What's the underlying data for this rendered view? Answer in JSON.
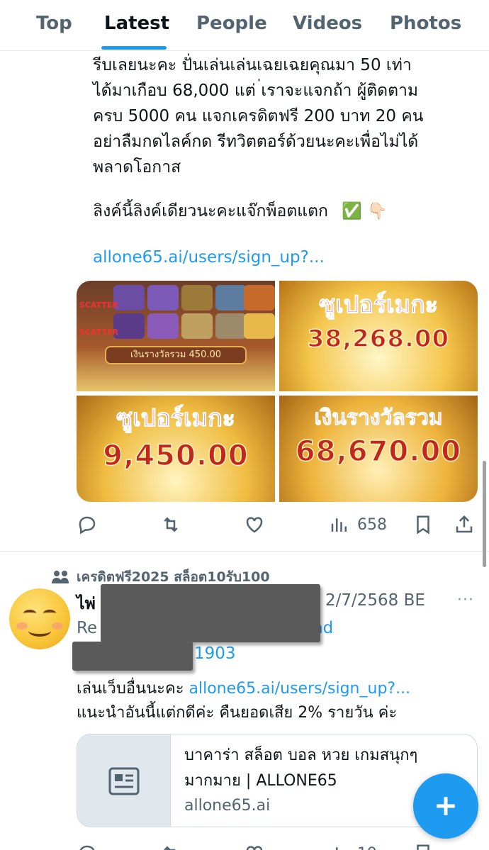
{
  "tabs": [
    {
      "label": "Top"
    },
    {
      "label": "Latest"
    },
    {
      "label": "People"
    },
    {
      "label": "Videos"
    },
    {
      "label": "Photos"
    }
  ],
  "active_tab": "Latest",
  "tweet1": {
    "text_lines": [
      "รีบเลยนะคะ ปั่นเล่นเล่นเฉยเฉยคุณมา 50 เท่า",
      "ได้มาเกือบ 68,000 แต่ ่เราจะแจกถ้า ผู้ติดตาม",
      "ครบ 5000 คน แจกเครดิตฟรี 200 บาท 20 คน",
      "อย่าลืมกดไลค์กด รีทวิตตอร์ด้วยนะคะเพื่อไม่ได้",
      "พลาดโอกาส"
    ],
    "link_line": "ลิงค์นี้ลิงค์เดียวนะคะแจ๊กพ็อตแตก",
    "link_emojis": "✅ 👇🏻",
    "url": "allone65.ai/users/sign_up?...",
    "media": {
      "tile_a_banner": "เงินรางวัลรวม 450.00",
      "tile_a_scatter": "SCATTER",
      "tile_b_title": "ซูเปอร์เมกะ",
      "tile_b_amount": "38,268.00",
      "tile_c_title": "ซูเปอร์เมกะ",
      "tile_c_amount": "9,450.00",
      "tile_d_title": "เงินรางวัลรวม",
      "tile_d_amount": "68,670.00"
    },
    "views": "658"
  },
  "tweet2": {
    "community": "เครดิตฟรี2025 สล็อต10รับ100",
    "name_visible": "ไพ่",
    "date": "2/7/2568 BE",
    "more": "···",
    "reply_prefix": "Re",
    "reply_suffix": "nd",
    "reply_line2": "1903",
    "text_line1_prefix": "เล่นเว็บอื่นนะคะ ",
    "text_line1_link": "allone65.ai/users/sign_up?...",
    "text_line2": "แนะนำอันนี้แต่กดีค่ะ คืนยอดเสีย 2% รายวัน ค่ะ",
    "card": {
      "title": "บาคาร่า สล็อต บอล หวย เกมสนุกๆ มากมาย | ALLONE65",
      "domain": "allone65.ai"
    },
    "views_partial": "19"
  },
  "colors": {
    "accent": "#1d9bf0",
    "text": "#0f1419",
    "secondary": "#536471",
    "border": "#e6e9ec"
  },
  "icons": [
    "reply-icon",
    "retweet-icon",
    "like-icon",
    "views-icon",
    "bookmark-icon",
    "share-icon",
    "community-icon",
    "article-icon",
    "compose-plus-icon"
  ]
}
